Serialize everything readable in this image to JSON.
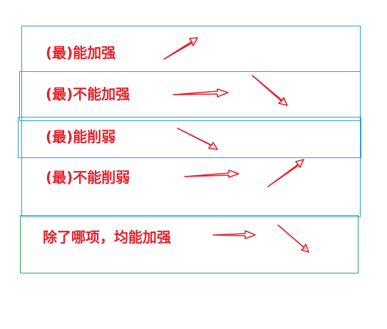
{
  "colors": {
    "text": "#e8202a",
    "blue_border": "#2a9fd8",
    "green_border": "#2ea84a",
    "arrow": "#e8202a"
  },
  "labels": {
    "strengthen_most": "(最)能加强",
    "not_strengthen_most": "(最)不能加强",
    "weaken_most": "(最)能削弱",
    "not_weaken_most": "(最)不能削弱",
    "except_strengthen": "除了哪项，均能加强"
  },
  "arrow_directions": [
    "up-right",
    "right",
    "down-right",
    "down-right",
    "right",
    "up-right",
    "right",
    "down-right"
  ]
}
